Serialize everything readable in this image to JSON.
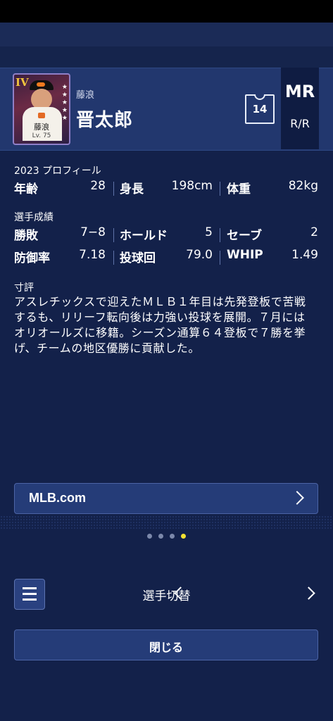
{
  "player": {
    "card_rank": "IV",
    "card_name": "藤浪",
    "card_level": "Lv. 75",
    "family_name": "藤浪",
    "given_name": "晋太郎",
    "number": "14",
    "position": "MR",
    "handedness": "R/R"
  },
  "profile": {
    "title": "2023 プロフィール",
    "age_label": "年齢",
    "age": "28",
    "height_label": "身長",
    "height": "198cm",
    "weight_label": "体重",
    "weight": "82kg"
  },
  "results": {
    "title": "選手成績",
    "wl_label": "勝敗",
    "wl": "7−8",
    "holds_label": "ホールド",
    "holds": "5",
    "saves_label": "セーブ",
    "saves": "2",
    "era_label": "防御率",
    "era": "7.18",
    "ip_label": "投球回",
    "ip": "79.0",
    "whip_label": "WHIP",
    "whip": "1.49"
  },
  "review": {
    "title": "寸評",
    "text": "アスレチックスで迎えたＭＬＢ１年目は先発登板で苦戦するも、リリーフ転向後は力強い投球を展開。７月にはオリオールズに移籍。シーズン通算６４登板で７勝を挙げ、チームの地区優勝に貢献した。"
  },
  "links": {
    "mlb_label": "MLB.com"
  },
  "pager": {
    "count": 4,
    "active": 4
  },
  "footer": {
    "switch_label": "選手切替",
    "close_label": "閉じる"
  },
  "colors": {
    "background": "#13214a",
    "header": "#22376e",
    "accent": "#f3e132"
  }
}
